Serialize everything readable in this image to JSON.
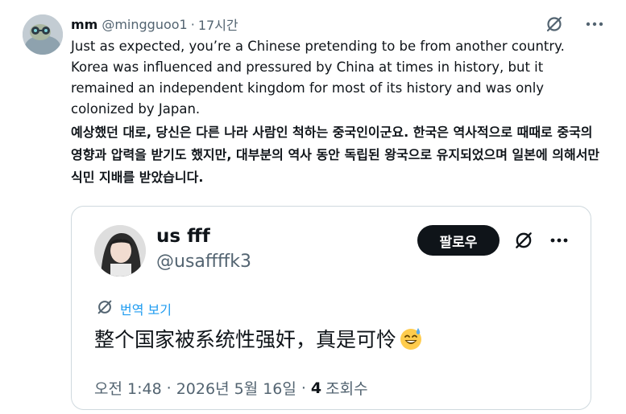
{
  "tweet": {
    "display_name": "mm",
    "handle": "@mingguoo1",
    "separator": "·",
    "time": "17시간",
    "text_en": "Just as expected, you’re a Chinese pretending to be from another country. Korea was influenced and pressured by China at times in history, but it remained an independent kingdom for most of its history and was only colonized by Japan.",
    "text_ko": "예상했던 대로, 당신은 다른 나라 사람인 척하는 중국인이군요. 한국은 역사적으로 때때로 중국의 영향과 압력을 받기도 했지만, 대부분의 역사 동안 독립된 왕국으로 유지되었으며 일본에 의해서만 식민 지배를 받았습니다.",
    "icons": [
      "grok-icon",
      "more-icon"
    ]
  },
  "quote": {
    "display_name": "us fff",
    "handle": "@usaffffk3",
    "follow_label": "팔로우",
    "translate_label": "번역 보기",
    "text": "整个国家被系统性强奸，真是可怜",
    "emoji": "sweat-smile-emoji",
    "time": "오전 1:48",
    "separator": "·",
    "date": "2026년 5월 16일",
    "views_count": "4",
    "views_label": "조회수"
  },
  "colors": {
    "text": "#0f1419",
    "secondary": "#536471",
    "link": "#1d9bf0",
    "border": "#cfd9de",
    "button_bg": "#0f1419"
  }
}
